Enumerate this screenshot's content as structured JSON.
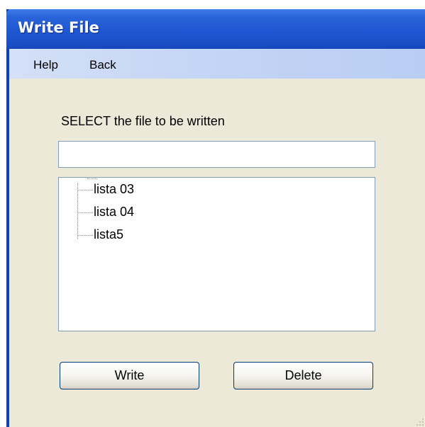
{
  "window": {
    "title": "Write File"
  },
  "menu": {
    "items": [
      {
        "label": "Help"
      },
      {
        "label": "Back"
      }
    ]
  },
  "form": {
    "select_label": "SELECT the file to be written",
    "file_input": {
      "value": "",
      "placeholder": ""
    },
    "files": [
      {
        "label": "lista 03"
      },
      {
        "label": "lista 04"
      },
      {
        "label": "lista5"
      }
    ]
  },
  "buttons": {
    "write_label": "Write",
    "delete_label": "Delete"
  },
  "colors": {
    "titlebar": "#1f57d2",
    "menubar": "#c6d6f5",
    "window_background": "#ece9d8",
    "button_border": "#003c74"
  }
}
